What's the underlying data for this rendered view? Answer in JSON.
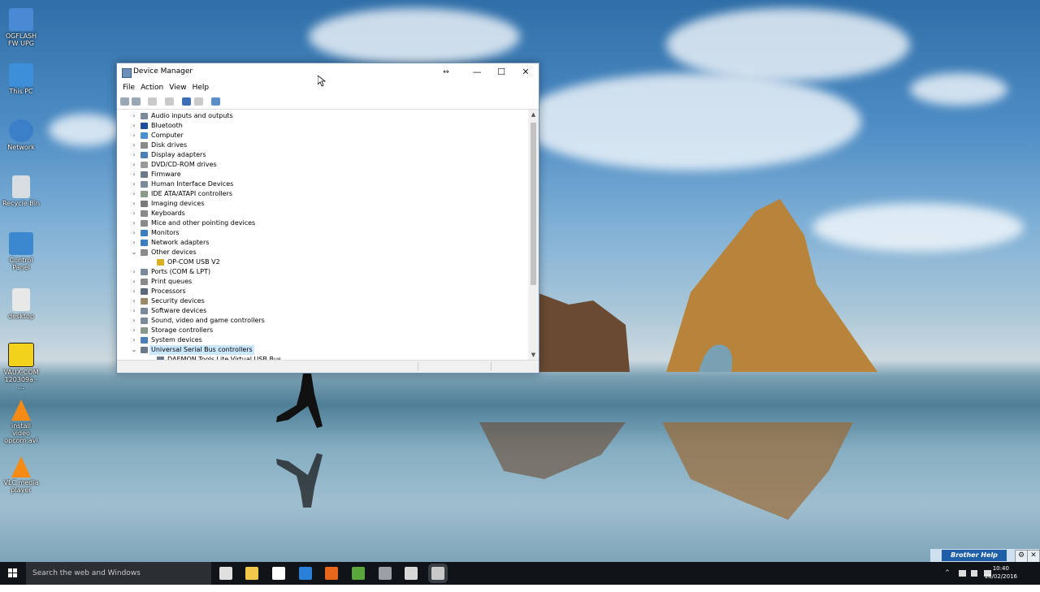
{
  "desktop": {
    "icons": [
      {
        "label": "OGFLASH FW UPG",
        "icon": "app-icon",
        "color": "#4a8ad4"
      },
      {
        "label": "This PC",
        "icon": "computer-icon",
        "color": "#3c8fd8"
      },
      {
        "label": "Network",
        "icon": "network-icon",
        "color": "#3a7fc8"
      },
      {
        "label": "Recycle Bin",
        "icon": "recycle-bin-icon",
        "color": "#d8dde2"
      },
      {
        "label": "Control Panel",
        "icon": "control-panel-icon",
        "color": "#3b88d0"
      },
      {
        "label": "desktop",
        "icon": "file-icon",
        "color": "#e8e8e8"
      },
      {
        "label": "VAUX-COM 120309a - ...",
        "icon": "vauxcom-icon",
        "color": "#f2d21a"
      },
      {
        "label": "install video opcom.avi",
        "icon": "vlc-icon",
        "color": "#f58b14"
      },
      {
        "label": "VLC media player",
        "icon": "vlc-icon",
        "color": "#f58b14"
      }
    ]
  },
  "window": {
    "title": "Device Manager",
    "menu": [
      "File",
      "Action",
      "View",
      "Help"
    ],
    "controls": {
      "minimize": "—",
      "maximize": "☐",
      "close": "✕",
      "resize": "↔"
    },
    "tree": [
      {
        "label": "Audio inputs and outputs",
        "arrow": "›",
        "level": 0,
        "icon": "speaker-icon",
        "color": "#7a8a9a"
      },
      {
        "label": "Bluetooth",
        "arrow": "›",
        "level": 0,
        "icon": "bluetooth-icon",
        "color": "#1e4f9c"
      },
      {
        "label": "Computer",
        "arrow": "›",
        "level": 0,
        "icon": "computer-icon",
        "color": "#4a90d0"
      },
      {
        "label": "Disk drives",
        "arrow": "›",
        "level": 0,
        "icon": "disk-icon",
        "color": "#8a8a8a"
      },
      {
        "label": "Display adapters",
        "arrow": "›",
        "level": 0,
        "icon": "display-icon",
        "color": "#4a7fb8"
      },
      {
        "label": "DVD/CD-ROM drives",
        "arrow": "›",
        "level": 0,
        "icon": "dvd-icon",
        "color": "#9a9a9a"
      },
      {
        "label": "Firmware",
        "arrow": "›",
        "level": 0,
        "icon": "firmware-icon",
        "color": "#6a7a8a"
      },
      {
        "label": "Human Interface Devices",
        "arrow": "›",
        "level": 0,
        "icon": "hid-icon",
        "color": "#7a8a9a"
      },
      {
        "label": "IDE ATA/ATAPI controllers",
        "arrow": "›",
        "level": 0,
        "icon": "ide-icon",
        "color": "#8a9a8a"
      },
      {
        "label": "Imaging devices",
        "arrow": "›",
        "level": 0,
        "icon": "camera-icon",
        "color": "#7a7a7a"
      },
      {
        "label": "Keyboards",
        "arrow": "›",
        "level": 0,
        "icon": "keyboard-icon",
        "color": "#8a8a8a"
      },
      {
        "label": "Mice and other pointing devices",
        "arrow": "›",
        "level": 0,
        "icon": "mouse-icon",
        "color": "#8a8a8a"
      },
      {
        "label": "Monitors",
        "arrow": "›",
        "level": 0,
        "icon": "monitor-icon",
        "color": "#3c7fc0"
      },
      {
        "label": "Network adapters",
        "arrow": "›",
        "level": 0,
        "icon": "network-adapter-icon",
        "color": "#3c7fc0"
      },
      {
        "label": "Other devices",
        "arrow": "⌄",
        "level": 0,
        "icon": "unknown-device-icon",
        "color": "#8a8a8a"
      },
      {
        "label": "OP-COM USB V2",
        "arrow": "",
        "level": 1,
        "icon": "warning-device-icon",
        "color": "#d8b020"
      },
      {
        "label": "Ports (COM & LPT)",
        "arrow": "›",
        "level": 0,
        "icon": "port-icon",
        "color": "#7a8a9a"
      },
      {
        "label": "Print queues",
        "arrow": "›",
        "level": 0,
        "icon": "printer-icon",
        "color": "#8a8a8a"
      },
      {
        "label": "Processors",
        "arrow": "›",
        "level": 0,
        "icon": "cpu-icon",
        "color": "#5a6a7a"
      },
      {
        "label": "Security devices",
        "arrow": "›",
        "level": 0,
        "icon": "security-icon",
        "color": "#9a8a6a"
      },
      {
        "label": "Software devices",
        "arrow": "›",
        "level": 0,
        "icon": "software-icon",
        "color": "#7a8a9a"
      },
      {
        "label": "Sound, video and game controllers",
        "arrow": "›",
        "level": 0,
        "icon": "sound-icon",
        "color": "#7a8a9a"
      },
      {
        "label": "Storage controllers",
        "arrow": "›",
        "level": 0,
        "icon": "storage-icon",
        "color": "#8a9a8a"
      },
      {
        "label": "System devices",
        "arrow": "›",
        "level": 0,
        "icon": "system-icon",
        "color": "#4a7fb8"
      },
      {
        "label": "Universal Serial Bus controllers",
        "arrow": "⌄",
        "level": 0,
        "icon": "usb-icon",
        "color": "#6a7a8a",
        "selected": true
      },
      {
        "label": "DAEMON Tools Lite Virtual USB Bus",
        "arrow": "",
        "level": 1,
        "icon": "usb-icon",
        "color": "#6a7a8a"
      }
    ]
  },
  "taskbar": {
    "search_placeholder": "Search the web and Windows",
    "apps": [
      {
        "icon": "task-view-icon",
        "color": "#e0e0e0"
      },
      {
        "icon": "file-explorer-icon",
        "color": "#f2c84b"
      },
      {
        "icon": "store-icon",
        "color": "#ffffff"
      },
      {
        "icon": "edge-icon",
        "color": "#2a7fd8"
      },
      {
        "icon": "firefox-icon",
        "color": "#e8661c"
      },
      {
        "icon": "utorrent-icon",
        "color": "#5aa83c"
      },
      {
        "icon": "network-tool-icon",
        "color": "#9aa0a6"
      },
      {
        "icon": "app-window-icon",
        "color": "#d8d8d8"
      },
      {
        "icon": "device-manager-icon",
        "color": "#c8c8c8"
      }
    ],
    "tray": {
      "chevron": "^",
      "time": "10:40",
      "date": "18/02/2016"
    }
  },
  "brother_help": {
    "label": "Brother Help"
  }
}
